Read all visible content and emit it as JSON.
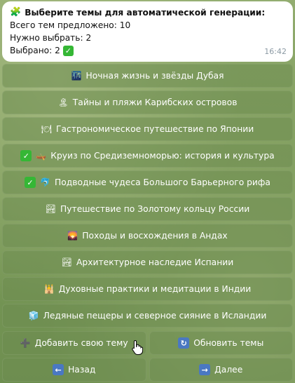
{
  "message": {
    "title": "Выберите темы для автоматической генерации:",
    "title_icon": "puzzle-icon",
    "lines": [
      "Всего тем предложено: 10",
      "Нужно выбрать: 2",
      "Выбрано: 2"
    ],
    "time": "16:42"
  },
  "topics": [
    {
      "icon": "night-city-icon",
      "glyph": "🌃",
      "label": "Ночная жизнь и звёзды Дубая",
      "checked": false
    },
    {
      "icon": "island-icon",
      "glyph": "🏝",
      "label": "Тайны и пляжи Карибских островов",
      "checked": false
    },
    {
      "icon": "plate-icon",
      "glyph": "🍽",
      "label": "Гастрономическое путешествие по Японии",
      "checked": false
    },
    {
      "icon": "canoe-icon",
      "glyph": "🛶",
      "label": "Круиз по Средиземноморью: история и культура",
      "checked": true
    },
    {
      "icon": "dolphin-icon",
      "glyph": "🐬",
      "label": "Подводные чудеса Большого Барьерного рифа",
      "checked": true
    },
    {
      "icon": "landscape-icon",
      "glyph": "🏞",
      "label": "Путешествие по Золотому кольцу России",
      "checked": false
    },
    {
      "icon": "sunset-mountain-icon",
      "glyph": "🌄",
      "label": "Походы и восхождения в Андах",
      "checked": false
    },
    {
      "icon": "mountain-landscape-icon",
      "glyph": "🏞",
      "label": "Архитектурное наследие Испании",
      "checked": false
    },
    {
      "icon": "temple-icon",
      "glyph": "🕌",
      "label": "Духовные практики и медитации в Индии",
      "checked": false
    },
    {
      "icon": "ice-icon",
      "glyph": "🧊",
      "label": "Ледяные пещеры и северное сияние в Исландии",
      "checked": false
    }
  ],
  "actions": {
    "add_label": "Добавить свою тему",
    "add_glyph": "➕",
    "refresh_label": "Обновить темы",
    "refresh_glyph": "🔄",
    "back_label": "Назад",
    "back_glyph": "⬅",
    "next_label": "Далее",
    "next_glyph": "➡"
  },
  "colors": {
    "check_green": "#35b735",
    "bubble_bg": "#ffffff",
    "time_gray": "#8c9aa4"
  }
}
